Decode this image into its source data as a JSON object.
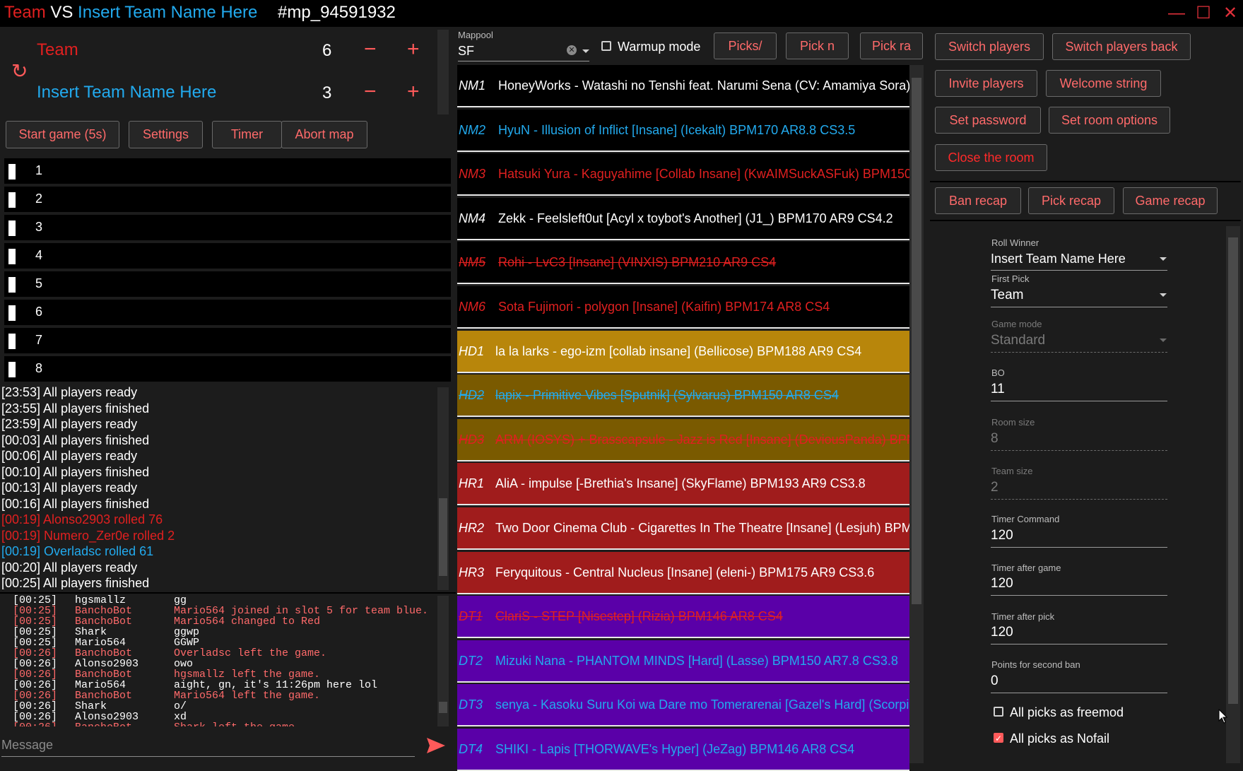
{
  "title": {
    "team1": "Team",
    "vs": "VS",
    "team2": "Insert Team Name Here",
    "match_id": "#mp_94591932"
  },
  "window": {
    "minimize": "—",
    "maximize": "☐",
    "close": "✕"
  },
  "teams": [
    {
      "name": "Team",
      "score": "6",
      "color": "#e02020"
    },
    {
      "name": "Insert Team Name Here",
      "score": "3",
      "color": "#22aaee"
    }
  ],
  "controls": {
    "minus": "−",
    "plus": "+",
    "refresh": "↻"
  },
  "actions": [
    "Start game (5s)",
    "Settings",
    "Timer",
    "Abort map"
  ],
  "slots": [
    "1",
    "2",
    "3",
    "4",
    "5",
    "6",
    "7",
    "8"
  ],
  "events": [
    {
      "text": "[23:53] All players ready",
      "color": "#ffffff"
    },
    {
      "text": "[23:55] All players finished",
      "color": "#ffffff"
    },
    {
      "text": "[23:59] All players ready",
      "color": "#ffffff"
    },
    {
      "text": "[00:03] All players finished",
      "color": "#ffffff"
    },
    {
      "text": "[00:06] All players ready",
      "color": "#ffffff"
    },
    {
      "text": "[00:10] All players finished",
      "color": "#ffffff"
    },
    {
      "text": "[00:13] All players ready",
      "color": "#ffffff"
    },
    {
      "text": "[00:16] All players finished",
      "color": "#ffffff"
    },
    {
      "text": "[00:19] Alonso2903 rolled 76",
      "color": "#e02020"
    },
    {
      "text": "[00:19] Numero_Zer0e rolled 2",
      "color": "#e02020"
    },
    {
      "text": "[00:19] Overladsc rolled 61",
      "color": "#22aaee"
    },
    {
      "text": "[00:20] All players ready",
      "color": "#ffffff"
    },
    {
      "text": "[00:25] All players finished",
      "color": "#ffffff"
    }
  ],
  "chat": [
    {
      "time": "[00:25]",
      "user": "hgsmallz",
      "msg": "gg",
      "color": "#ffffff"
    },
    {
      "time": "[00:25]",
      "user": "BanchoBot",
      "msg": "Mario564 joined in slot 5 for team blue.",
      "color": "#ff6a6a"
    },
    {
      "time": "[00:25]",
      "user": "BanchoBot",
      "msg": "Mario564 changed to Red",
      "color": "#ff6a6a"
    },
    {
      "time": "[00:25]",
      "user": "Shark",
      "msg": "ggwp",
      "color": "#ffffff"
    },
    {
      "time": "[00:25]",
      "user": "Mario564",
      "msg": "GGWP",
      "color": "#ffffff"
    },
    {
      "time": "[00:26]",
      "user": "BanchoBot",
      "msg": "Overladsc left the game.",
      "color": "#ff6a6a"
    },
    {
      "time": "[00:26]",
      "user": "Alonso2903",
      "msg": "owo",
      "color": "#ffffff"
    },
    {
      "time": "[00:26]",
      "user": "BanchoBot",
      "msg": "hgsmallz left the game.",
      "color": "#ff6a6a"
    },
    {
      "time": "[00:26]",
      "user": "Mario564",
      "msg": "aight, gn, it's 11:26pm here lol",
      "color": "#ffffff"
    },
    {
      "time": "[00:26]",
      "user": "BanchoBot",
      "msg": "Mario564 left the game.",
      "color": "#ff6a6a"
    },
    {
      "time": "[00:26]",
      "user": "Shark",
      "msg": "o/",
      "color": "#ffffff"
    },
    {
      "time": "[00:26]",
      "user": "Alonso2903",
      "msg": "xd",
      "color": "#ffffff"
    },
    {
      "time": "[00:26]",
      "user": "BanchoBot",
      "msg": "Shark left the game.",
      "color": "#ff6a6a"
    }
  ],
  "message": {
    "placeholder": "Message",
    "send_icon": "send-icon"
  },
  "mappool": {
    "label": "Mappool",
    "value": "SF",
    "warmup_label": "Warmup mode",
    "buttons": [
      "Picks/",
      "Pick n",
      "Pick ra"
    ],
    "maps": [
      {
        "code": "NM1",
        "title": "HoneyWorks - Watashi no Tenshi feat. Narumi Sena (CV: Amamiya Sora)",
        "bg": "#000000",
        "color": "#ffffff",
        "struck": false
      },
      {
        "code": "NM2",
        "title": "HyuN - Illusion of Inflict [Insane] (Icekalt) BPM170 AR8.8 CS3.5",
        "bg": "#000000",
        "color": "#22aaee",
        "struck": false
      },
      {
        "code": "NM3",
        "title": "Hatsuki Yura - Kaguyahime [Collab Insane] (KwAIMSuckASFuk) BPM150",
        "bg": "#000000",
        "color": "#e02020",
        "struck": false
      },
      {
        "code": "NM4",
        "title": "Zekk - Feelsleft0ut [Acyl x toybot's Another] (J1_) BPM170 AR9 CS4.2",
        "bg": "#000000",
        "color": "#ffffff",
        "struck": false
      },
      {
        "code": "NM5",
        "title": "Rohi - LvC3 [Insane] (VINXIS) BPM210 AR9 CS4",
        "bg": "#000000",
        "color": "#e02020",
        "struck": true
      },
      {
        "code": "NM6",
        "title": "Sota Fujimori - polygon [Insane] (Kaifin) BPM174 AR8 CS4",
        "bg": "#000000",
        "color": "#e02020",
        "struck": false
      },
      {
        "code": "HD1",
        "title": "la la larks - ego-izm [collab insane] (Bellicose) BPM188 AR9 CS4",
        "bg": "#b8860b",
        "color": "#ffffff",
        "struck": false
      },
      {
        "code": "HD2",
        "title": "lapix - Primitive Vibes [Sputnik] (Sylvarus) BPM150 AR8 CS4",
        "bg": "#7a5a00",
        "color": "#22aaee",
        "struck": true
      },
      {
        "code": "HD3",
        "title": "ARM (IOSYS) + Brasscapsule - Jazz is Red [Insane] (DeviousPanda) BPM",
        "bg": "#7a5a00",
        "color": "#e02020",
        "struck": true
      },
      {
        "code": "HR1",
        "title": "AliA - impulse [-Brethia's Insane] (SkyFlame) BPM193 AR9 CS3.8",
        "bg": "#a01c1c",
        "color": "#ffffff",
        "struck": false
      },
      {
        "code": "HR2",
        "title": "Two Door Cinema Club - Cigarettes In The Theatre [Insane] (Lesjuh) BPM",
        "bg": "#a01c1c",
        "color": "#ffffff",
        "struck": false
      },
      {
        "code": "HR3",
        "title": "Feryquitous - Central Nucleus [Insane] (eleni-) BPM175 AR9 CS3.6",
        "bg": "#a01c1c",
        "color": "#ffffff",
        "struck": false
      },
      {
        "code": "DT1",
        "title": "ClariS - STEP [Nisestep] (Rizia) BPM146 AR8 CS4",
        "bg": "#5a00a8",
        "color": "#e02020",
        "struck": true
      },
      {
        "code": "DT2",
        "title": "Mizuki Nana - PHANTOM MINDS [Hard] (Lasse) BPM150 AR7.8 CS3.8",
        "bg": "#5a00a8",
        "color": "#22aaee",
        "struck": false
      },
      {
        "code": "DT3",
        "title": "senya - Kasoku Suru Koi wa Dare mo Tomerarenai [Gazel's Hard] (Scorpiour)",
        "bg": "#5a00a8",
        "color": "#22aaee",
        "struck": false
      },
      {
        "code": "DT4",
        "title": "SHIKI - Lapis [THORWAVE's Hyper] (JeZag) BPM146 AR8 CS4",
        "bg": "#5a00a8",
        "color": "#22aaee",
        "struck": false
      }
    ]
  },
  "room_buttons": {
    "switch_players": "Switch players",
    "switch_back": "Switch players back",
    "invite": "Invite players",
    "welcome": "Welcome string",
    "set_password": "Set password",
    "set_room_options": "Set room options",
    "close_room": "Close the room",
    "ban_recap": "Ban recap",
    "pick_recap": "Pick recap",
    "game_recap": "Game recap"
  },
  "settings": {
    "roll_winner": {
      "label": "Roll Winner",
      "value": "Insert Team Name Here"
    },
    "first_pick": {
      "label": "First Pick",
      "value": "Team"
    },
    "game_mode": {
      "label": "Game mode",
      "value": "Standard"
    },
    "bo": {
      "label": "BO",
      "value": "11"
    },
    "room_size": {
      "label": "Room size",
      "value": "8"
    },
    "team_size": {
      "label": "Team size",
      "value": "2"
    },
    "timer_command": {
      "label": "Timer Command",
      "value": "120"
    },
    "timer_after_game": {
      "label": "Timer after game",
      "value": "120"
    },
    "timer_after_pick": {
      "label": "Timer after pick",
      "value": "120"
    },
    "points_second_ban": {
      "label": "Points for second ban",
      "value": "0"
    },
    "freemod": {
      "label": "All picks as freemod",
      "checked": false
    },
    "nofail": {
      "label": "All picks as Nofail",
      "checked": true
    }
  }
}
